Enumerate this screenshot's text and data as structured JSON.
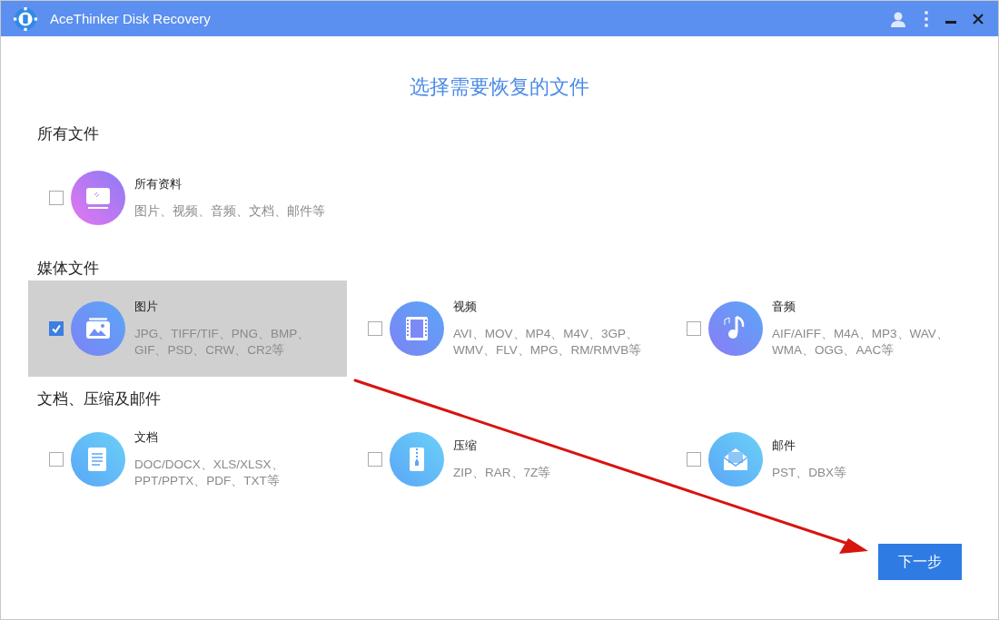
{
  "window": {
    "title": "AceThinker Disk Recovery"
  },
  "heading": "选择需要恢复的文件",
  "sections": [
    {
      "title": "所有文件",
      "items": [
        {
          "kind": "monitor",
          "label": "所有资料",
          "description": "图片、视频、音频、文档、邮件等",
          "checked": false,
          "selected": false
        }
      ]
    },
    {
      "title": "媒体文件",
      "items": [
        {
          "kind": "picture",
          "label": "图片",
          "description": "JPG、TIFF/TIF、PNG、BMP、GIF、PSD、CRW、CR2等",
          "checked": true,
          "selected": true
        },
        {
          "kind": "film",
          "label": "视频",
          "description": "AVI、MOV、MP4、M4V、3GP、WMV、FLV、MPG、RM/RMVB等",
          "checked": false,
          "selected": false
        },
        {
          "kind": "music",
          "label": "音频",
          "description": "AIF/AIFF、M4A、MP3、WAV、WMA、OGG、AAC等",
          "checked": false,
          "selected": false
        }
      ]
    },
    {
      "title": "文档、压缩及邮件",
      "items": [
        {
          "kind": "document",
          "label": "文档",
          "description": "DOC/DOCX、XLS/XLSX、PPT/PPTX、PDF、TXT等",
          "checked": false,
          "selected": false
        },
        {
          "kind": "zip",
          "label": "压缩",
          "description": "ZIP、RAR、7Z等",
          "checked": false,
          "selected": false
        },
        {
          "kind": "mail",
          "label": "邮件",
          "description": "PST、DBX等",
          "checked": false,
          "selected": false
        }
      ]
    }
  ],
  "next_button": "下一步"
}
